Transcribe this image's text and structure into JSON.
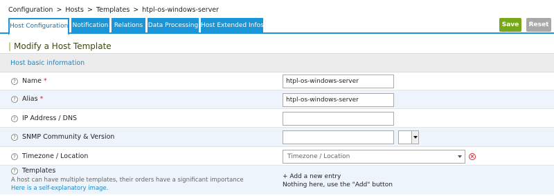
{
  "breadcrumb": {
    "items": [
      "Configuration",
      "Hosts",
      "Templates",
      "htpl-os-windows-server"
    ],
    "separator": ">"
  },
  "tabs": [
    {
      "label": "Host Configuration",
      "active": true
    },
    {
      "label": "Notification",
      "active": false
    },
    {
      "label": "Relations",
      "active": false
    },
    {
      "label": "Data Processing",
      "active": false
    },
    {
      "label": "Host Extended Infos",
      "active": false
    }
  ],
  "toolbar": {
    "save_label": "Save",
    "reset_label": "Reset"
  },
  "page": {
    "title": "Modify a Host Template",
    "title_marker": "|"
  },
  "section": {
    "title": "Host basic information"
  },
  "form": {
    "help_glyph": "?",
    "required_mark": "*",
    "name": {
      "label": "Name",
      "value": "htpl-os-windows-server"
    },
    "alias": {
      "label": "Alias",
      "value": "htpl-os-windows-server"
    },
    "ip": {
      "label": "IP Address / DNS",
      "value": ""
    },
    "snmp": {
      "label": "SNMP Community & Version",
      "value": "",
      "version": ""
    },
    "timezone": {
      "label": "Timezone / Location",
      "placeholder": "Timezone / Location",
      "clear_glyph": "×"
    },
    "templates": {
      "label": "Templates",
      "description": "A host can have multiple templates, their orders have a significant importance",
      "link_text": "Here is a self-explanatory image.",
      "add_entry": "+ Add a new entry",
      "empty_text": "Nothing here, use the \"Add\" button"
    }
  },
  "colors": {
    "tab_blue": "#1a95d8",
    "save_green": "#77a81a",
    "reset_gray": "#a8a8a8",
    "required_red": "#d9232e",
    "link_blue": "#1a85c8"
  }
}
